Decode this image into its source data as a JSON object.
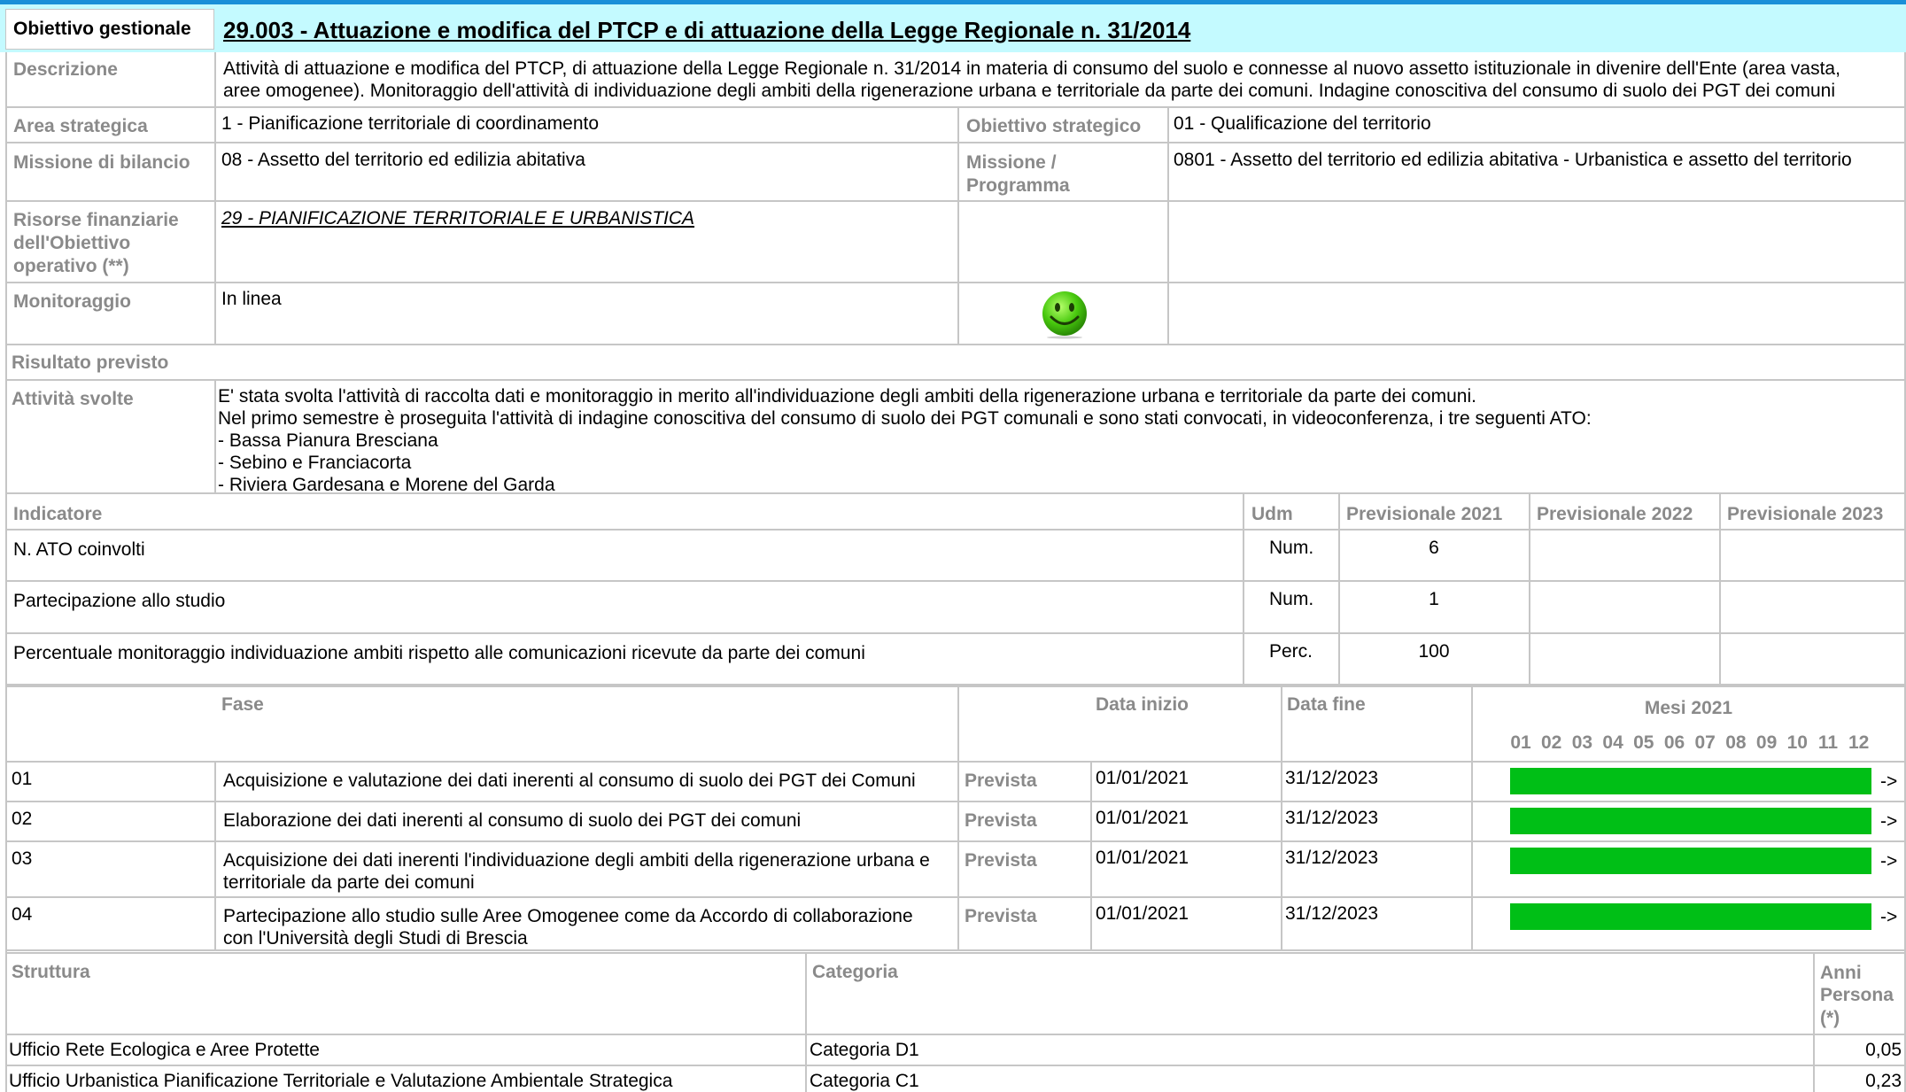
{
  "header": {
    "label": "Obiettivo gestionale",
    "title": "29.003 - Attuazione e modifica del PTCP e di attuazione della Legge Regionale n. 31/2014"
  },
  "descrizione": {
    "label": "Descrizione",
    "line1": "Attività di attuazione e modifica del PTCP, di attuazione della Legge Regionale n. 31/2014 in materia di consumo del suolo e connesse al nuovo assetto istituzionale in divenire dell'Ente (area vasta,",
    "line2": "aree omogenee). Monitoraggio dell'attività di individuazione degli ambiti della rigenerazione urbana e territoriale da parte dei comuni. Indagine conoscitiva del consumo di suolo dei PGT dei comuni"
  },
  "area_strategica": {
    "label": "Area strategica",
    "value": "1 - Pianificazione territoriale di coordinamento"
  },
  "obiettivo_strategico": {
    "label": "Obiettivo strategico",
    "value": "01 - Qualificazione del territorio"
  },
  "missione_bilancio": {
    "label": "Missione di bilancio",
    "value": "08 - Assetto del territorio ed edilizia abitativa"
  },
  "missione_programma": {
    "label1": "Missione /",
    "label2": "Programma",
    "value": "0801 - Assetto del territorio ed edilizia abitativa - Urbanistica e assetto del territorio"
  },
  "risorse": {
    "label1": "Risorse finanziarie",
    "label2": "dell'Obiettivo",
    "label3": "operativo (**)",
    "value": "29 - PIANIFICAZIONE TERRITORIALE E URBANISTICA"
  },
  "monitoraggio": {
    "label": "Monitoraggio",
    "value": "In linea",
    "status_icon": "smiley-green-icon",
    "status_color": "#3cb20c"
  },
  "risultato_previsto": {
    "label": "Risultato previsto"
  },
  "attivita_svolte": {
    "label": "Attività svolte",
    "lines": [
      "E' stata svolta l'attività di raccolta dati e monitoraggio in merito all'individuazione degli ambiti della rigenerazione urbana e territoriale da parte dei comuni.",
      "Nel primo semestre è proseguita l'attività di indagine conoscitiva del consumo di suolo dei PGT comunali e sono stati convocati, in videoconferenza, i tre seguenti ATO:",
      "- Bassa Pianura Bresciana",
      "- Sebino e Franciacorta",
      "- Riviera Gardesana e Morene del Garda"
    ]
  },
  "indicatori": {
    "headers": {
      "indicatore": "Indicatore",
      "udm": "Udm",
      "p2021": "Previsionale 2021",
      "p2022": "Previsionale 2022",
      "p2023": "Previsionale 2023"
    },
    "rows": [
      {
        "name": "N. ATO coinvolti",
        "udm": "Num.",
        "p2021": "6"
      },
      {
        "name": "Partecipazione allo studio",
        "udm": "Num.",
        "p2021": "1"
      },
      {
        "name": "Percentuale monitoraggio individuazione ambiti rispetto alle comunicazioni ricevute da parte dei comuni",
        "udm": "Perc.",
        "p2021": "100"
      }
    ]
  },
  "fasi": {
    "headers": {
      "fase": "Fase",
      "data_inizio": "Data inizio",
      "data_fine": "Data fine",
      "mesi": "Mesi 2021"
    },
    "months": [
      "01",
      "02",
      "03",
      "04",
      "05",
      "06",
      "07",
      "08",
      "09",
      "10",
      "11",
      "12"
    ],
    "bar_color": "#00bf16",
    "rows": [
      {
        "num": "01",
        "lines": [
          "Acquisizione e valutazione dei dati inerenti al consumo di suolo dei PGT dei Comuni"
        ],
        "stato": "Prevista",
        "inizio": "01/01/2021",
        "fine": "31/12/2023",
        "arrow": "->",
        "months_from": 1,
        "months_to": 12
      },
      {
        "num": "02",
        "lines": [
          "Elaborazione dei dati inerenti al consumo di suolo dei PGT dei comuni"
        ],
        "stato": "Prevista",
        "inizio": "01/01/2021",
        "fine": "31/12/2023",
        "arrow": "->",
        "months_from": 1,
        "months_to": 12
      },
      {
        "num": "03",
        "lines": [
          "Acquisizione dei dati inerenti l'individuazione degli ambiti della rigenerazione urbana e",
          "territoriale da parte dei comuni"
        ],
        "stato": "Prevista",
        "inizio": "01/01/2021",
        "fine": "31/12/2023",
        "arrow": "->",
        "months_from": 1,
        "months_to": 12
      },
      {
        "num": "04",
        "lines": [
          "Partecipazione allo studio sulle Aree Omogenee come da Accordo di collaborazione",
          "con l'Università degli Studi di Brescia"
        ],
        "stato": "Prevista",
        "inizio": "01/01/2021",
        "fine": "31/12/2023",
        "arrow": "->",
        "months_from": 1,
        "months_to": 12
      }
    ]
  },
  "struttura": {
    "headers": {
      "struttura": "Struttura",
      "categoria": "Categoria",
      "anni1": "Anni",
      "anni2": "Persona",
      "anni3": "(*)"
    },
    "rows": [
      {
        "struttura": "Ufficio Rete Ecologica e Aree Protette",
        "categoria": "Categoria D1",
        "anni": "0,05"
      },
      {
        "struttura": "Ufficio Urbanistica Pianificazione Territoriale e Valutazione Ambientale Strategica",
        "categoria": "Categoria C1",
        "anni": "0,23"
      }
    ]
  }
}
